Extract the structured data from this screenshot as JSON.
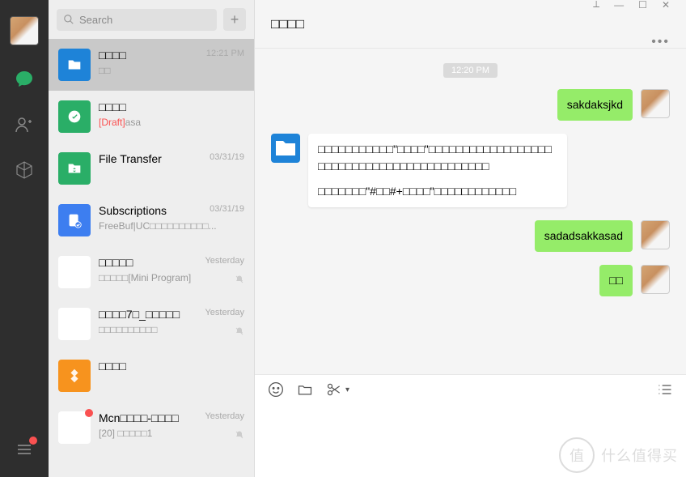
{
  "search": {
    "placeholder": "Search"
  },
  "chats": [
    {
      "title": "□□□□",
      "sub": "□□",
      "time": "12:21 PM",
      "active": true,
      "avatarColor": "#1e83d8",
      "icon": "folder"
    },
    {
      "title": "□□□□",
      "draft": "[Draft]",
      "sub": "asa",
      "avatarColor": "#2aae67",
      "icon": "wechat"
    },
    {
      "title": "File Transfer",
      "time": "03/31/19",
      "avatarColor": "#2aae67",
      "icon": "transfer"
    },
    {
      "title": "Subscriptions",
      "sub": "FreeBuf|UC□□□□□□□□□□...",
      "time": "03/31/19",
      "avatarColor": "#3d7ef0",
      "icon": "subs"
    },
    {
      "title": "□□□□□",
      "sub": "□□□□□[Mini Program]",
      "time": "Yesterday",
      "gridAvatar": true,
      "muted": true
    },
    {
      "title": "□□□□7□_□□□□□",
      "sub": "□□□□□□□□□□",
      "time": "Yesterday",
      "gridAvatar": true,
      "muted": true
    },
    {
      "title": "□□□□",
      "avatarColor": "#f7931e",
      "icon": "diamond"
    },
    {
      "title": "Mcn□□□□-□□□□",
      "sub": "[20] □□□□□1",
      "time": "Yesterday",
      "gridAvatar": true,
      "muted": true,
      "badge": true
    }
  ],
  "pane": {
    "title": "□□□□",
    "timestamp": "12:20 PM",
    "messages": [
      {
        "dir": "out",
        "text": "sakdaksjkd"
      },
      {
        "dir": "in",
        "lines": [
          "□□□□□□□□□□□\"□□□□\"□□□□□□□□□□□□□□□□□□□□□□□□□□□□□□□□□□□□□□□□□□□",
          "□□□□□□□\"#□□#+□□□□\"□□□□□□□□□□□□"
        ]
      },
      {
        "dir": "out",
        "text": "sadadsakkasad"
      },
      {
        "dir": "out",
        "text": "□□"
      }
    ]
  },
  "watermark": {
    "circle": "值",
    "text": "什么值得买"
  }
}
